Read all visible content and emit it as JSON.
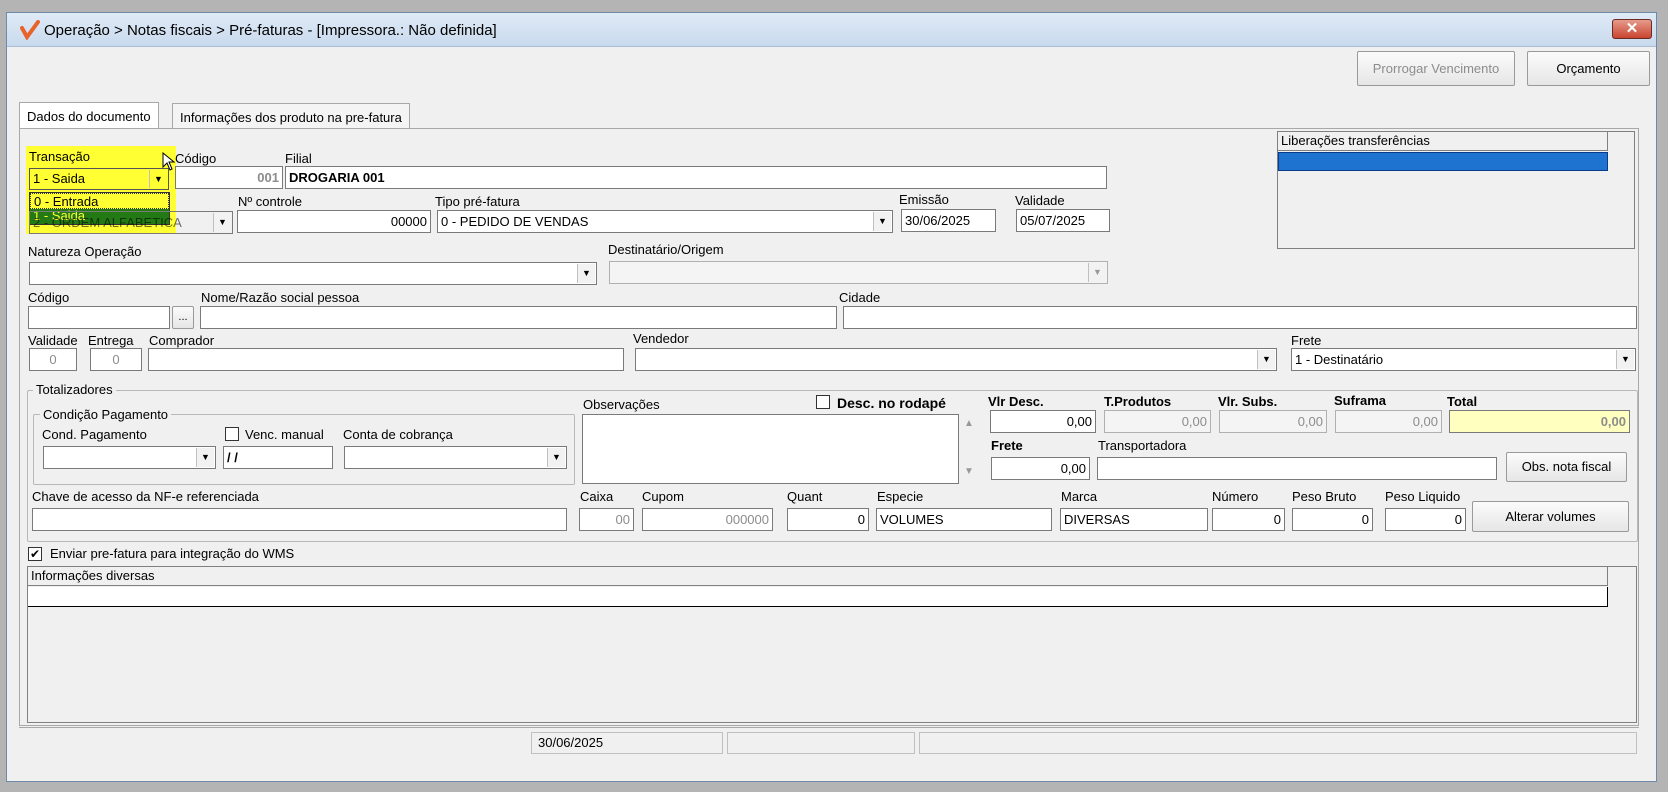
{
  "window": {
    "title": "Operação > Notas fiscais > Pré-faturas - [Impressora.: Não definida]",
    "close_symbol": "✕"
  },
  "toolbar": {
    "prorrogar_label": "Prorrogar Vencimento",
    "orcamento_label": "Orçamento"
  },
  "tabs": [
    {
      "label": "Dados do documento"
    },
    {
      "label": "Informações dos produto na pre-fatura"
    }
  ],
  "form": {
    "transacao_label": "Transação",
    "transacao_value": "1 - Saida",
    "transacao_options": [
      "0 - Entrada",
      "1 - Saida"
    ],
    "hidden_select_fragment": "2 - ORDEM ALFABETICA",
    "codigo_label": "Código",
    "codigo_value": "001",
    "filial_label": "Filial",
    "filial_value": "DROGARIA 001",
    "ncontrole_label": "Nº controle",
    "ncontrole_value": "00000",
    "tipo_label": "Tipo pré-fatura",
    "tipo_value": "0  - PEDIDO DE VENDAS",
    "emissao_label": "Emissão",
    "emissao_value": "30/06/2025",
    "validade_label": "Validade",
    "validade_value": "05/07/2025",
    "liberacoes_label": "Liberações transferências",
    "natureza_label": "Natureza  Operação",
    "destinatario_label": "Destinatário/Origem",
    "codigo2_label": "Código",
    "ellipsis": "...",
    "nome_label": "Nome/Razão social pessoa",
    "cidade_label": "Cidade",
    "validade2_label": "Validade",
    "validade2_value": "0",
    "entrega_label": "Entrega",
    "entrega_value": "0",
    "comprador_label": "Comprador",
    "vendedor_label": "Vendedor",
    "frete_label": "Frete",
    "frete_value": "1 - Destinatário"
  },
  "totalizadores": {
    "title": "Totalizadores",
    "condicao_title": "Condição Pagamento",
    "cond_pag_label": "Cond. Pagamento",
    "venc_manual_label": "Venc. manual",
    "venc_value": " / /",
    "conta_label": "Conta de cobrança",
    "observacoes_label": "Observações",
    "desc_rodape_label": "Desc. no rodapé",
    "vlr_desc_label": "Vlr Desc.",
    "vlr_desc_value": "0,00",
    "tprodutos_label": "T.Produtos",
    "tprodutos_value": "0,00",
    "vlr_subs_label": "Vlr. Subs.",
    "vlr_subs_value": "0,00",
    "suframa_label": "Suframa",
    "suframa_value": "0,00",
    "total_label": "Total",
    "total_value": "0,00",
    "frete_label": "Frete",
    "frete_value": "0,00",
    "transportadora_label": "Transportadora",
    "obs_nota_label": "Obs. nota fiscal",
    "chave_label": "Chave de acesso da NF-e referenciada",
    "caixa_label": "Caixa",
    "caixa_value": "00",
    "cupom_label": "Cupom",
    "cupom_value": "000000",
    "quant_label": "Quant",
    "quant_value": "0",
    "especie_label": "Especie",
    "especie_value": "VOLUMES",
    "marca_label": "Marca",
    "marca_value": "DIVERSAS",
    "numero_label": "Número",
    "numero_value": "0",
    "peso_bruto_label": "Peso Bruto",
    "peso_bruto_value": "0",
    "peso_liquido_label": "Peso Liquido",
    "peso_liquido_value": "0",
    "alterar_volumes_label": "Alterar volumes"
  },
  "wms": {
    "label": "Enviar pre-fatura para integração do WMS",
    "checked": true,
    "check_symbol": "✔"
  },
  "info": {
    "label": "Informações diversas"
  },
  "statusbar": {
    "date": "30/06/2025"
  },
  "colors": {
    "highlight": "#ffff33",
    "selection": "#1e73d1",
    "total_bg": "#ffffc0"
  }
}
